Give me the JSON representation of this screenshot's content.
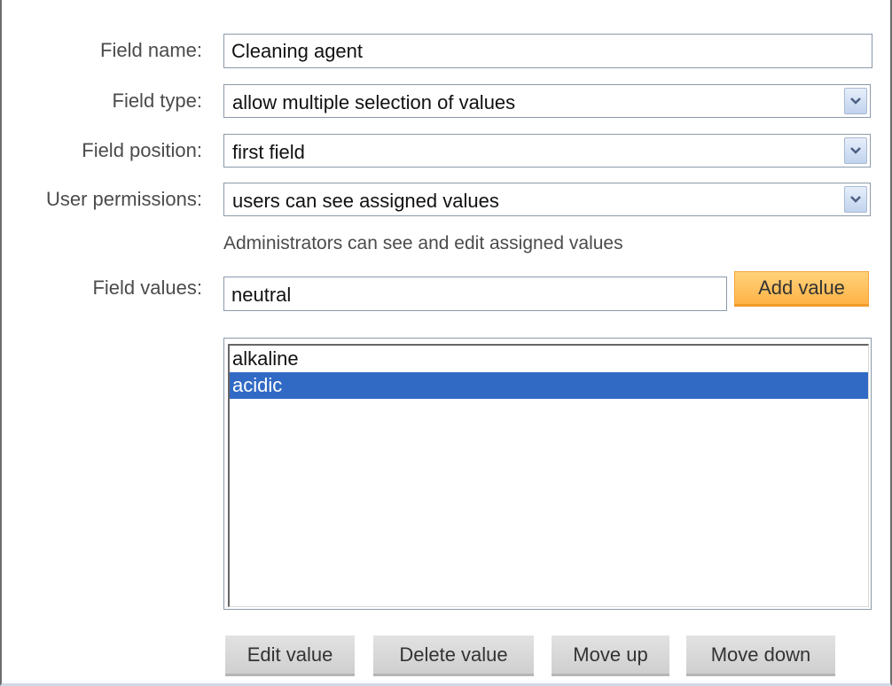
{
  "form": {
    "field_name": {
      "label": "Field name:",
      "value": "Cleaning agent"
    },
    "field_type": {
      "label": "Field type:",
      "value": "allow multiple selection of values"
    },
    "field_position": {
      "label": "Field position:",
      "value": "first field"
    },
    "user_permissions": {
      "label": "User permissions:",
      "value": "users can see assigned values",
      "hint": "Administrators can see and edit assigned values"
    },
    "field_values": {
      "label": "Field values:",
      "input_value": "neutral",
      "add_button_label": "Add value",
      "items": [
        {
          "label": "alkaline",
          "selected": false
        },
        {
          "label": "acidic",
          "selected": true
        }
      ]
    },
    "buttons": {
      "edit": "Edit value",
      "delete": "Delete value",
      "move_up": "Move up",
      "move_down": "Move down"
    }
  },
  "icons": {
    "dropdown": "chevron-down-icon"
  },
  "colors": {
    "selection": "#316ac5",
    "add_button": "#ffb347",
    "secondary_button": "#d8d8d8"
  }
}
